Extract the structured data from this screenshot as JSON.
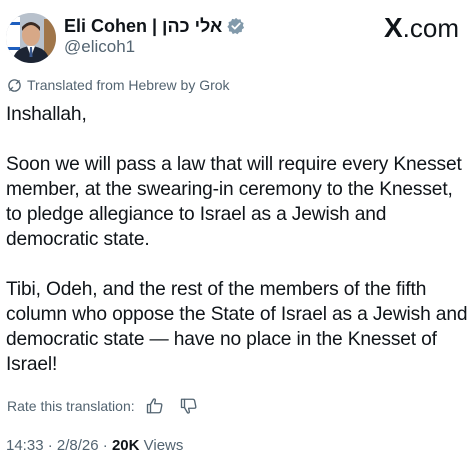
{
  "header": {
    "display_name": "Eli Cohen | אלי כהן",
    "handle": "@elicoh1",
    "site_logo_mark": "X",
    "site_logo_suffix": ".com",
    "verified_icon": "verified-badge-icon",
    "brand_verified_color": "#829aab"
  },
  "translation": {
    "label": "Translated from Hebrew by Grok",
    "icon": "grok-icon"
  },
  "post": {
    "paragraphs": [
      "Inshallah,",
      "Soon we will pass a law that will require every Knesset member, at the swearing-in ceremony to the Knesset, to pledge allegiance to Israel as a Jewish and democratic state.",
      "Tibi, Odeh, and the rest of the members of the fifth column who oppose the State of Israel as a Jewish and democratic state — have no place in the Knesset of Israel!"
    ]
  },
  "rating": {
    "label": "Rate this translation:",
    "thumbs_up_icon": "thumbs-up-icon",
    "thumbs_down_icon": "thumbs-down-icon"
  },
  "meta": {
    "time": "14:33",
    "separator": " · ",
    "date": "2/8/26",
    "views_count": "20K",
    "views_label": " Views"
  },
  "colors": {
    "text_primary": "#0f1419",
    "text_secondary": "#536471"
  }
}
